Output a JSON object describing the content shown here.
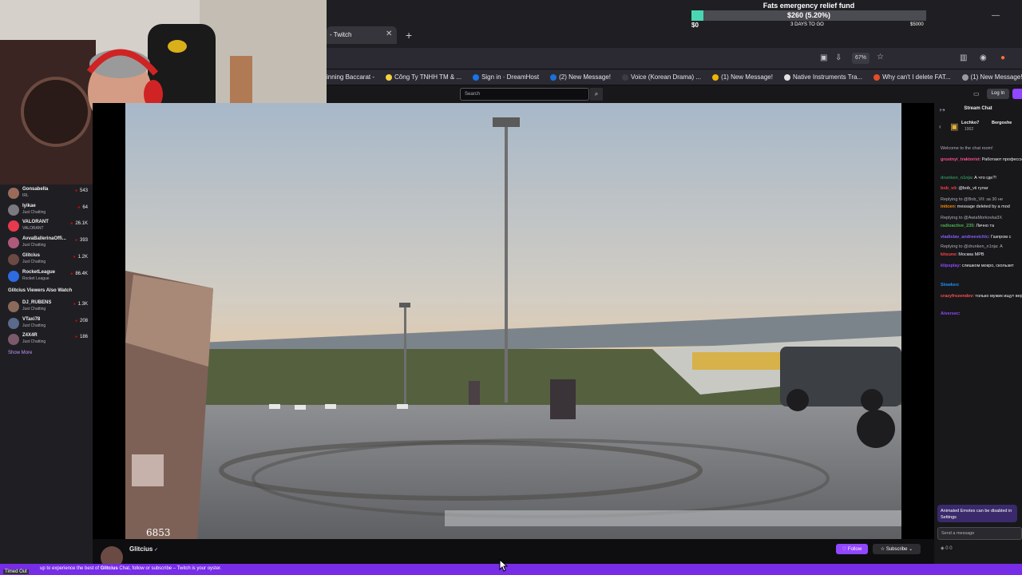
{
  "browser": {
    "tab_title": "- Twitch",
    "zoom": "67%",
    "bookmarks": [
      {
        "label": "inning Baccarat -",
        "color": "#3c3c44"
      },
      {
        "label": "Công Ty TNHH TM & ...",
        "color": "#f4d23c"
      },
      {
        "label": "Sign in · DreamHost",
        "color": "#1a73e8"
      },
      {
        "label": "(2) New Message!",
        "color": "#1d6fd8"
      },
      {
        "label": "Voice (Korean Drama) ...",
        "color": "#3c3c44"
      },
      {
        "label": "(1) New Message!",
        "color": "#f0b400"
      },
      {
        "label": "Native Instruments Tra...",
        "color": "#e2e2e2"
      },
      {
        "label": "Why can't I delete FAT...",
        "color": "#e44d26"
      },
      {
        "label": "(1) New Message!",
        "color": "#9a9aa0"
      }
    ]
  },
  "fund": {
    "title": "Fats emergency relief fund",
    "amount": "$260 (5.20%)",
    "progress_percent": 5.2,
    "start": "$0",
    "days": "3 DAYS TO GO",
    "goal": "$5000"
  },
  "twitch": {
    "search_placeholder": "Search",
    "login_label": "Log In"
  },
  "sidebar": {
    "channels": [
      {
        "name": "Gonsabella",
        "game": "IRL",
        "viewers": "543",
        "color": "#9b6b5a"
      },
      {
        "name": "Iyikae",
        "game": "Just Chatting",
        "viewers": "64",
        "color": "#7a7a80"
      },
      {
        "name": "VALORANT",
        "game": "VALORANT",
        "viewers": "26.1K",
        "color": "#e8394f"
      },
      {
        "name": "AvvaBallerinaOffi...",
        "game": "Just Chatting",
        "viewers": "393",
        "color": "#b05a7a"
      },
      {
        "name": "Glitcius",
        "game": "Just Chatting",
        "viewers": "1.2K",
        "color": "#6b4a44"
      },
      {
        "name": "RocketLeague",
        "game": "Rocket League",
        "viewers": "86.4K",
        "color": "#2d6be0"
      }
    ],
    "also_watch_title": "Glitcius Viewers Also Watch",
    "also_watch": [
      {
        "name": "DJ_RUBENS",
        "game": "Just Chatting",
        "viewers": "1.3K",
        "color": "#8a6a5a"
      },
      {
        "name": "VTaxi78",
        "game": "Just Chatting",
        "viewers": "208",
        "color": "#5a6a8a"
      },
      {
        "name": "Z4X4R",
        "game": "Just Chatting",
        "viewers": "186",
        "color": "#7a5a6a"
      }
    ],
    "show_more": "Show More"
  },
  "video": {
    "overlay_number": "6853"
  },
  "channel": {
    "name": "Glitcius",
    "follow_label": "Follow",
    "subscribe_label": "Subscribe"
  },
  "chat": {
    "title": "Stream Chat",
    "leaders": [
      {
        "name": "Lechko7",
        "points": "1002"
      },
      {
        "name": "Bergoshe",
        "points": ""
      }
    ],
    "welcome": "Welcome to the chat room!",
    "messages": [
      {
        "user": "grustnyi_traktorist",
        "text": ": Работают профессионалы",
        "color": "#ff4d8d"
      },
      {
        "user": "drunken_n1nja",
        "text": ": А что где?!",
        "color": "#2e8b57"
      },
      {
        "user": "bob_vii",
        "text": ": @bob_vii гулаг",
        "color": "#ff4040"
      },
      {
        "user": "",
        "text": "Replying to @Bob_VII: за 30 не",
        "color": "#adadb8"
      },
      {
        "user": "inticen",
        "text": ": message deleted by a mod",
        "color": "#ff8c00"
      },
      {
        "user": "",
        "text": "Replying to @AwiaMorkovka3X",
        "color": "#adadb8"
      },
      {
        "user": "radioactive_235",
        "text": ": Лично та",
        "color": "#4caf50"
      },
      {
        "user": "vladislav_andreevichlc",
        "text": ": Газпром с",
        "color": "#8a5cff"
      },
      {
        "user": "",
        "text": "Replying to @drunken_n1nja: А",
        "color": "#adadb8"
      },
      {
        "user": "kitsune",
        "text": ": Москва МРВ",
        "color": "#ff4040"
      },
      {
        "user": "klipsplay",
        "text": ": слишком мокро, скользит",
        "color": "#9147ff"
      },
      {
        "user": "Slowkex",
        "text": ":",
        "color": "#1e90ff"
      },
      {
        "user": "crazyfrozendov",
        "text": ": только мужик ищут вертолёт в небе",
        "color": "#ff4d4d"
      },
      {
        "user": "Aiversec",
        "text": ":",
        "color": "#9147ff"
      }
    ],
    "emote_note": "Animated Emotes can be disabled in Settings",
    "input_placeholder": "Send a message",
    "footer": "0   0"
  },
  "banner": {
    "prefix": "up to experience the best of",
    "channel": "Glitcius",
    "suffix": "Chat, follow or subscribe – Twitch is your oyster.",
    "timed_out": "Timed Out"
  }
}
